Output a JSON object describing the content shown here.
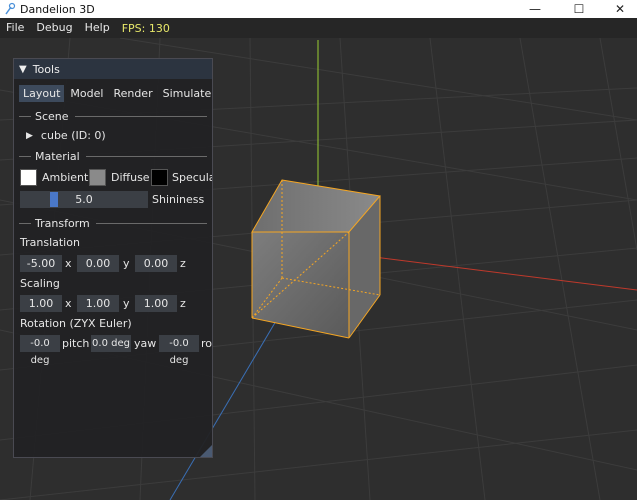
{
  "window": {
    "title": "Dandelion 3D",
    "icon": "dandelion-app-icon",
    "controls": {
      "minimize": "—",
      "maximize": "☐",
      "close": "✕"
    }
  },
  "menubar": {
    "items": [
      "File",
      "Debug",
      "Help"
    ],
    "fps": "FPS: 130"
  },
  "tools": {
    "title": "Tools",
    "tabs": [
      "Layout",
      "Model",
      "Render",
      "Simulate"
    ],
    "active_tab": "Layout",
    "scene": {
      "header": "Scene",
      "node": "cube (ID: 0)"
    },
    "material": {
      "header": "Material",
      "ambient_label": "Ambient",
      "ambient_color": "#ffffff",
      "diffuse_label": "Diffuse",
      "diffuse_color": "#8a8a8a",
      "specular_label": "Specula",
      "specular_color": "#000000",
      "shininess_value": "5.0",
      "shininess_label": "Shininess",
      "shininess_fraction": 0.25
    },
    "transform": {
      "header": "Transform",
      "translation_label": "Translation",
      "translation": {
        "x": "-5.00",
        "y": "0.00",
        "z": "0.00"
      },
      "scaling_label": "Scaling",
      "scaling": {
        "x": "1.00",
        "y": "1.00",
        "z": "1.00"
      },
      "rotation_label": "Rotation (ZYX Euler)",
      "rotation": {
        "pitch": "-0.0 deg",
        "yaw": "0.0 deg",
        "roll": "-0.0 deg"
      },
      "axis_x": "x",
      "axis_y": "y",
      "axis_z": "z",
      "pitch_label": "pitch",
      "yaw_label": "yaw",
      "roll_label": "ro"
    }
  },
  "colors": {
    "x_axis": "#c0392b",
    "y_axis": "#9acd32",
    "z_axis": "#3a6fb5",
    "selection_outline": "#f5a623",
    "accent": "#3d4a5c"
  }
}
